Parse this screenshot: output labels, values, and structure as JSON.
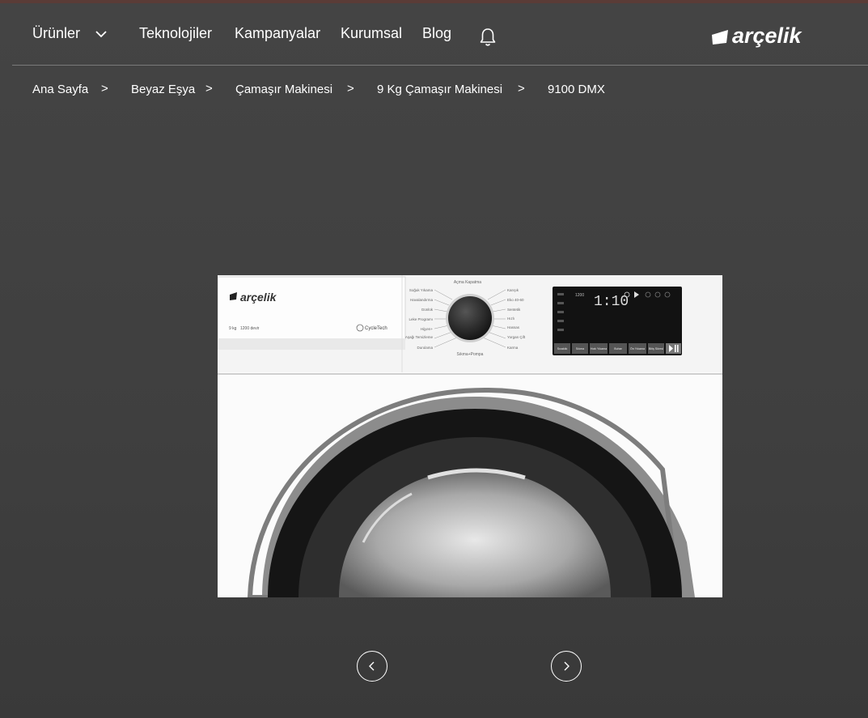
{
  "nav": {
    "products_label": "Ürünler",
    "technologies_label": "Teknolojiler",
    "campaigns_label": "Kampanyalar",
    "corporate_label": "Kurumsal",
    "blog_label": "Blog",
    "logo_text": "arçelik"
  },
  "breadcrumb": {
    "items": [
      "Ana Sayfa",
      "Beyaz Eşya",
      "Çamaşır Makinesi",
      "9 Kg Çamaşır Makinesi",
      "9100 DMX"
    ],
    "separator": ">"
  },
  "product": {
    "brand_text": "arçelik",
    "capacity_text": "9 kg",
    "speed_text": "1200 devir",
    "tech_badge": "CycleTech",
    "programs_left": [
      "Soğuk Yıkama",
      "Havalandırma",
      "Günlük",
      "Leke Programı",
      "Hijyen+",
      "Aşağı Temizleme",
      "Durulama"
    ],
    "programs_right": [
      "Karışık",
      "Eko 40-60",
      "Sentetik",
      "Hızlı",
      "Hassas",
      "Yorgan Çift",
      "Karma"
    ],
    "programs_top": "Açma Kapatma",
    "programs_bottom": "Sıkma+Pompa",
    "display_time": "1:10",
    "display_speed": "1200",
    "panel_buttons": [
      "Sıcaklık",
      "Sıkma",
      "Hızlı Yıkama",
      "Buhar",
      "Ön Yıkama",
      "Bitiş Süresi"
    ]
  },
  "colors": {
    "background": "#424242",
    "topbar": "#5a3c37",
    "text": "#ffffff",
    "divider": "#7a7a7a"
  },
  "icons": {
    "chevron": "chevron-down-icon",
    "bell": "bell-icon",
    "prev": "chevron-left-icon",
    "next": "chevron-right-icon"
  }
}
